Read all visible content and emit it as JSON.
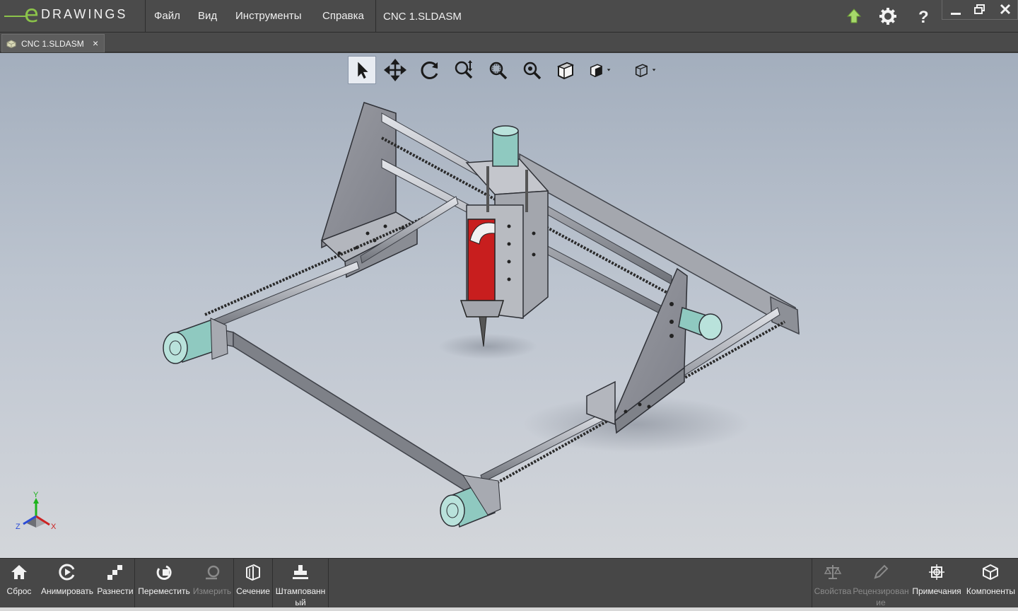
{
  "app": {
    "logo_letter": "e",
    "logo_word": "DRAWINGS",
    "logo_mark": "®",
    "document_title": "CNC 1.SLDASM"
  },
  "menu": {
    "file": "Файл",
    "view": "Вид",
    "tools": "Инструменты",
    "help": "Справка"
  },
  "tab": {
    "label": "CNC 1.SLDASM",
    "close": "×"
  },
  "view_toolbar": {
    "tools": [
      "select-arrow",
      "pan",
      "rotate",
      "zoom-fit",
      "zoom-area",
      "zoom",
      "view-orientation",
      "display-style",
      "section-views"
    ]
  },
  "triad": {
    "x": "X",
    "y": "Y",
    "z": "Z"
  },
  "bottom_toolbar": {
    "reset": "Сброс",
    "animate": "Анимировать",
    "explode": "Разнести",
    "move": "Переместить",
    "measure": "Измерить",
    "section": "Сечение",
    "stamp": "Штампованный",
    "properties": "Свойства",
    "review": "Рецензирование",
    "markup": "Примечания",
    "components": "Компоненты"
  },
  "colors": {
    "accent": "#8bc34a",
    "titlebar": "#4b4b4b",
    "viewport_top": "#a3aebd",
    "viewport_bottom": "#d3d6da",
    "part_steel": "#8e9098",
    "motor": "#8fc9c0",
    "spindle_red": "#c81e1e"
  }
}
